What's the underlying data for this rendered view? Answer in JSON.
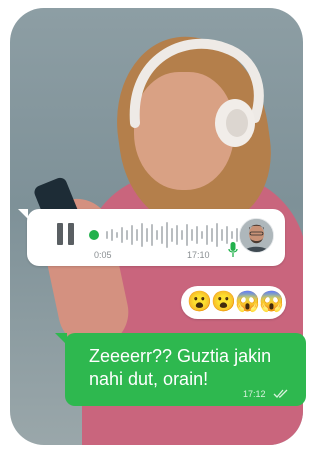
{
  "voice_message": {
    "elapsed": "0:05",
    "timestamp": "17:10",
    "state_icon": "pause-icon",
    "mic_icon": "microphone-icon",
    "colors": {
      "accent": "#22b14c",
      "bubble": "#ffffff"
    }
  },
  "reaction": {
    "emojis": [
      "😮",
      "😮",
      "😱",
      "😱"
    ]
  },
  "outgoing_message": {
    "text": "Zeeeerr?? Guztia jakin nahi dut, orain!",
    "time": "17:12",
    "status_icon": "double-check-icon",
    "colors": {
      "bubble": "#2eb84f",
      "text": "#ffffff"
    }
  }
}
